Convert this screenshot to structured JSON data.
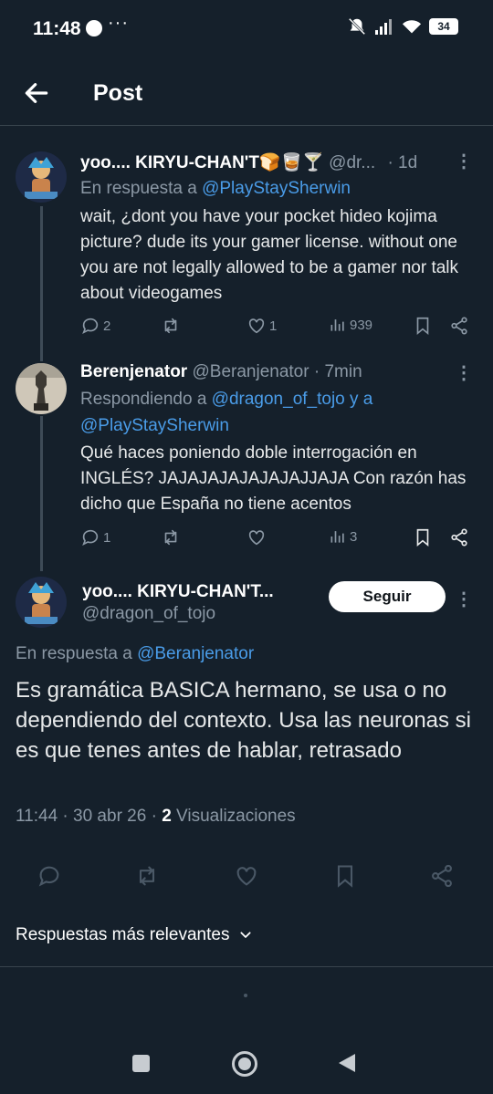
{
  "status": {
    "time": "11:48",
    "dots": "···",
    "battery": "34"
  },
  "header": {
    "title": "Post"
  },
  "tweets": [
    {
      "name": "yoo.... KIRYU-CHAN'T🍞🥃🍸",
      "handle": "@dr...",
      "time": "· 1d",
      "reply_prefix": "En respuesta a ",
      "reply_to": "@PlayStaySherwin",
      "text": "wait, ¿dont you have your pocket hideo kojima picture? dude its your gamer license. without one you are not legally allowed to be a gamer nor talk about videogames",
      "replies": "2",
      "retweets": "",
      "likes": "1",
      "views": "939"
    },
    {
      "name": "Berenjenator",
      "handle": "@Beranjenator",
      "time": "· 7min",
      "reply_prefix": "Respondiendo a ",
      "reply_to": "@dragon_of_tojo y a @PlayStaySherwin",
      "text": "Qué haces poniendo doble interrogación en INGLÉS? JAJAJAJAJAJAJAJJAJA Con razón has dicho que España no tiene acentos",
      "replies": "1",
      "retweets": "",
      "likes": "",
      "views": "3"
    }
  ],
  "main": {
    "name": "yoo.... KIRYU-CHAN'T...",
    "handle": "@dragon_of_tojo",
    "follow_label": "Seguir",
    "reply_prefix": "En respuesta a ",
    "reply_to": "@Beranjenator",
    "text": "Es gramática BASICA hermano, se usa o no dependiendo del contexto. Usa las neuronas si es que tenes antes de hablar, retrasado",
    "time": "11:44 · 30 abr 26 · ",
    "views_count": "2",
    "views_label": " Visualizaciones"
  },
  "sort_label": "Respuestas más relevantes",
  "colors": {
    "bg": "#15202b",
    "link": "#4a9ce8",
    "muted": "#8b98a5"
  }
}
